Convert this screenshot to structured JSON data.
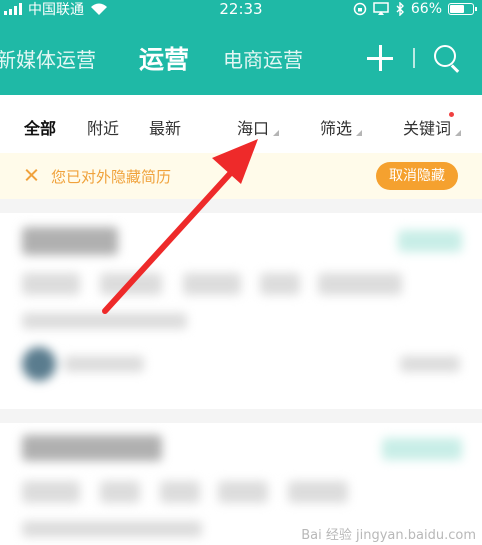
{
  "status_bar": {
    "carrier": "中国联通",
    "time": "22:33",
    "battery": "66%",
    "battery_level": 0.66,
    "icons": [
      "signal-icon",
      "wifi-icon",
      "lock-rotation-icon",
      "screen-mirror-icon",
      "bluetooth-icon",
      "battery-icon"
    ]
  },
  "nav": {
    "tabs": [
      {
        "label": "新媒体运营"
      },
      {
        "label": "运营",
        "active": true
      },
      {
        "label": "电商运营"
      }
    ],
    "icons": [
      "add-icon",
      "search-icon"
    ]
  },
  "filters": {
    "items": [
      {
        "label": "全部",
        "active": true
      },
      {
        "label": "附近"
      },
      {
        "label": "最新"
      },
      {
        "label": "海口",
        "dropdown": true
      },
      {
        "label": "筛选",
        "dropdown": true
      },
      {
        "label": "关键词",
        "dropdown": true,
        "badge": true
      }
    ]
  },
  "notice": {
    "text": "您已对外隐藏简历",
    "button": "取消隐藏",
    "color": "#f0a23b"
  },
  "colors": {
    "header": "#1fb9a6",
    "arrow": "#ee2a2a",
    "notice_bg": "#fffbea",
    "button": "#f5a12f"
  },
  "watermark": "Bai 经验 jingyan.baidu.com"
}
